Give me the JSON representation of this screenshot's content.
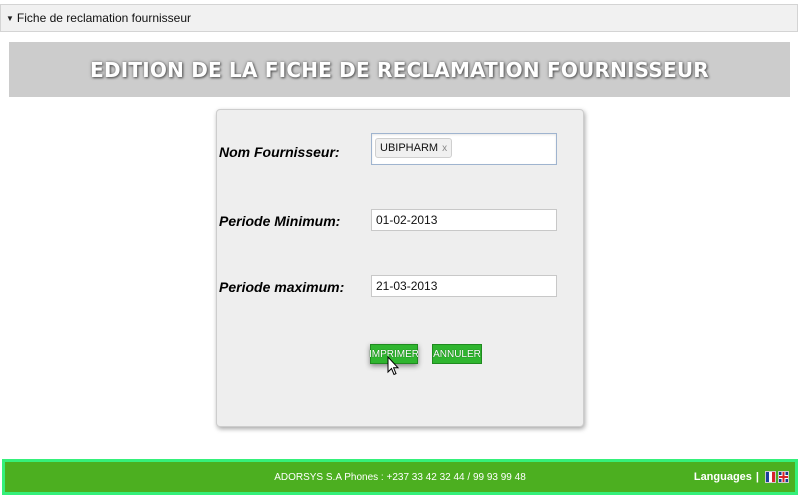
{
  "panel": {
    "title": "Fiche de reclamation fournisseur"
  },
  "banner": {
    "title": "EDITION DE LA FICHE DE RECLAMATION FOURNISSEUR"
  },
  "form": {
    "supplier_label": "Nom Fournisseur:",
    "supplier_chip": "UBIPHARM",
    "chip_remove": "x",
    "period_min_label": "Periode Minimum:",
    "period_min_value": "01-02-2013",
    "period_max_label": "Periode maximum:",
    "period_max_value": "21-03-2013",
    "print_label": "IMPRIMER",
    "cancel_label": "ANNULER"
  },
  "footer": {
    "company_text": "ADORSYS S.A Phones : +237 33 42 32 44 / 99 93 99 48",
    "languages_label": "Languages",
    "separator": "|"
  },
  "colors": {
    "button_green": "#2fb52f",
    "footer_green": "#4caf20",
    "footer_border": "#35f07a",
    "banner_gray": "#cccccc"
  },
  "icons": [
    "collapse-triangle-icon",
    "flag-fr-icon",
    "flag-uk-icon",
    "mouse-cursor-icon"
  ]
}
